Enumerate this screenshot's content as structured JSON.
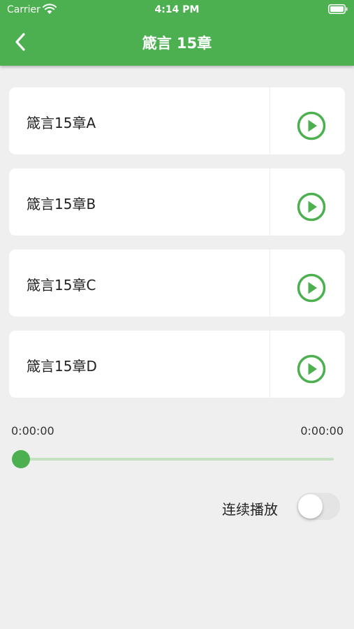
{
  "status_bar": {
    "carrier": "Carrier",
    "time": "4:14 PM",
    "wifi_icon": "wifi-icon",
    "battery_icon": "battery-icon"
  },
  "header": {
    "title": "箴言 15章",
    "back_icon": "chevron-left-icon",
    "background": "#4caf50"
  },
  "tracks": [
    {
      "label": "箴言15章A",
      "icon": "play-circle-icon"
    },
    {
      "label": "箴言15章B",
      "icon": "play-circle-icon"
    },
    {
      "label": "箴言15章C",
      "icon": "play-circle-icon"
    },
    {
      "label": "箴言15章D",
      "icon": "play-circle-icon"
    }
  ],
  "player": {
    "current_time": "0:00:00",
    "total_time": "0:00:00",
    "progress": 0
  },
  "continuous_play": {
    "label": "连续播放",
    "enabled": false
  },
  "colors": {
    "accent": "#4caf50",
    "track_background": "#c4e2c2",
    "page_background": "#efefef"
  }
}
